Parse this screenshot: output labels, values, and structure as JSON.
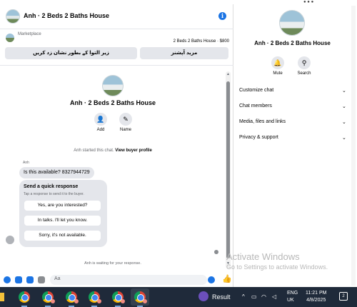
{
  "chat": {
    "title": "Anh · 2 Beds 2 Baths House",
    "marketplace_label": "Marketplace",
    "listing": "2 Beds 2 Baths House · $800",
    "btn_more_options": "مزید آپشنز",
    "btn_mark_pending": "زیر التوا کے بطور نشان زد کریں",
    "thread_title": "Anh · 2 Beds 2 Baths House",
    "actions": [
      {
        "label": "Add",
        "icon": "add-person-icon"
      },
      {
        "label": "Name",
        "icon": "pencil-icon"
      }
    ],
    "started_text": "Anh started this chat.",
    "view_profile": "View buyer profile",
    "sender_name": "Anh",
    "message": "Is this available? 8327944729",
    "quick_title": "Send a quick response",
    "quick_subtitle": "Tap a response to send it to the buyer.",
    "quick_responses": [
      "Yes, are you interested?",
      "In talks. I'll let you know.",
      "Sorry, it's not available."
    ],
    "waiting": "Anh is waiting for your response.",
    "composer_placeholder": "Aa"
  },
  "info_panel": {
    "name": "Anh · 2 Beds 2 Baths House",
    "actions": [
      {
        "label": "Mute",
        "icon": "bell-icon"
      },
      {
        "label": "Search",
        "icon": "search-icon"
      }
    ],
    "menu": [
      "Customize chat",
      "Chat members",
      "Media, files and links",
      "Privacy & support"
    ]
  },
  "watermark": {
    "line1": "Activate Windows",
    "line2": "Go to Settings to activate Windows."
  },
  "taskbar": {
    "result_label": "Result",
    "lang_1": "ENG",
    "lang_2": "UK",
    "time": "11:21 PM",
    "date": "4/8/2025",
    "notif_count": "2"
  },
  "colors": {
    "accent": "#1b74e4",
    "bubble": "#e4e6eb",
    "taskbar": "#1f2a3a"
  }
}
